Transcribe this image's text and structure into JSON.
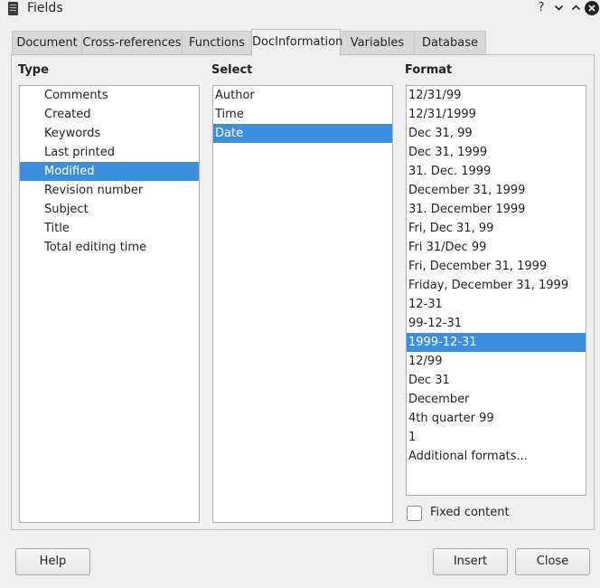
{
  "window": {
    "title": "Fields"
  },
  "titlebar_buttons": {
    "help": "?",
    "minimize": "minimize",
    "maximize": "maximize",
    "close": "close"
  },
  "tabs": [
    {
      "label": "Document",
      "active": false
    },
    {
      "label": "Cross-references",
      "active": false
    },
    {
      "label": "Functions",
      "active": false
    },
    {
      "label": "DocInformation",
      "active": true
    },
    {
      "label": "Variables",
      "active": false
    },
    {
      "label": "Database",
      "active": false
    }
  ],
  "type": {
    "label": "Type",
    "items": [
      "Comments",
      "Created",
      "Keywords",
      "Last printed",
      "Modified",
      "Revision number",
      "Subject",
      "Title",
      "Total editing time"
    ],
    "selected": "Modified"
  },
  "select": {
    "label": "Select",
    "items": [
      "Author",
      "Time",
      "Date"
    ],
    "selected": "Date"
  },
  "format": {
    "label": "Format",
    "items": [
      "12/31/99",
      "12/31/1999",
      "Dec 31, 99",
      "Dec 31, 1999",
      "31. Dec. 1999",
      "December 31, 1999",
      "31. December 1999",
      "Fri, Dec 31, 99",
      "Fri 31/Dec 99",
      "Fri, December 31, 1999",
      "Friday, December 31, 1999",
      "12-31",
      "99-12-31",
      "1999-12-31",
      "12/99",
      "Dec 31",
      "December",
      "4th quarter 99",
      "1",
      "Additional formats..."
    ],
    "selected": "1999-12-31"
  },
  "fixed_content": {
    "label": "Fixed content",
    "checked": false
  },
  "buttons": {
    "help": "Help",
    "insert": "Insert",
    "close": "Close"
  }
}
